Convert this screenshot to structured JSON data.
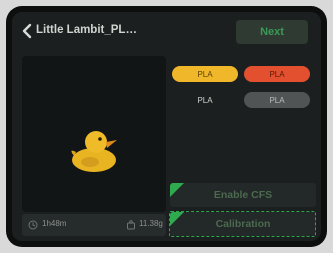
{
  "header": {
    "title": "Little Lambit_PL…",
    "next_label": "Next"
  },
  "preview": {
    "model_icon": "rubber-duck",
    "print_time": "1h48m",
    "weight": "11.38g"
  },
  "filaments": [
    {
      "label": "PLA",
      "color": "#f0b72a"
    },
    {
      "label": "PLA",
      "color": "#e2502f"
    },
    {
      "label": "PLA",
      "color": ""
    },
    {
      "label": "PLA",
      "color": "#505455"
    }
  ],
  "options": {
    "enable_cfs": "Enable CFS",
    "calibration": "Calibration"
  },
  "colors": {
    "accent_green": "#3b9a55",
    "background": "#1b1f1f"
  }
}
